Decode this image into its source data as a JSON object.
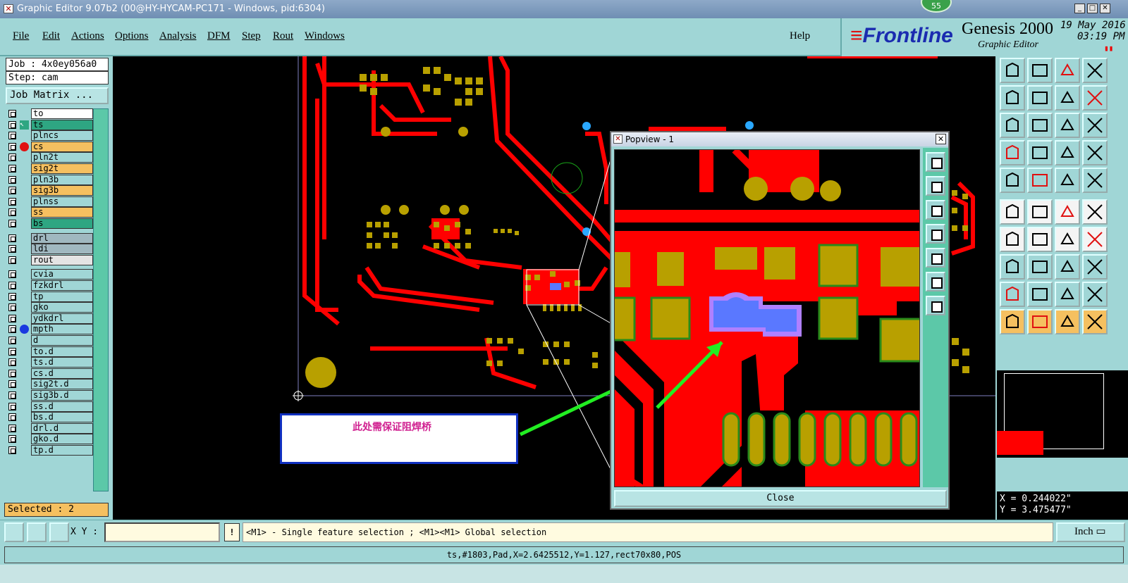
{
  "window": {
    "title": "Graphic Editor 9.07b2 (00@HY-HYCAM-PC171 - Windows, pid:6304)",
    "badge": "55"
  },
  "menu": [
    "File",
    "Edit",
    "Actions",
    "Options",
    "Analysis",
    "DFM",
    "Step",
    "Rout",
    "Windows"
  ],
  "help": "Help",
  "brand": {
    "logo": "Frontline",
    "product": "Genesis 2000",
    "subtitle": "Graphic Editor",
    "date": "19 May 2016",
    "time": "03:19 PM"
  },
  "job": {
    "job_label": "Job : 4x0ey056a0",
    "step_label": "Step: cam",
    "matrix_button": "Job Matrix ..."
  },
  "layers": [
    {
      "name": "to",
      "color": "#ffffff",
      "dot": ""
    },
    {
      "name": "ts",
      "color": "#2ea682",
      "dot": "arrow"
    },
    {
      "name": "plncs",
      "color": "#a0d6d6",
      "dot": ""
    },
    {
      "name": "cs",
      "color": "#f5c060",
      "dot": "#e01010"
    },
    {
      "name": "pln2t",
      "color": "#a0d6d6",
      "dot": ""
    },
    {
      "name": "sig2t",
      "color": "#f5c060",
      "dot": ""
    },
    {
      "name": "pln3b",
      "color": "#a0d6d6",
      "dot": ""
    },
    {
      "name": "sig3b",
      "color": "#f5c060",
      "dot": ""
    },
    {
      "name": "plnss",
      "color": "#a0d6d6",
      "dot": ""
    },
    {
      "name": "ss",
      "color": "#f5c060",
      "dot": ""
    },
    {
      "name": "bs",
      "color": "#2ea682",
      "dot": ""
    },
    {
      "name": "drl",
      "color": "#a0b8c0",
      "dot": ""
    },
    {
      "name": "ldi",
      "color": "#a0b8c0",
      "dot": ""
    },
    {
      "name": "rout",
      "color": "#e4e4e4",
      "dot": ""
    },
    {
      "name": "cvia",
      "color": "#a0d6d6",
      "dot": ""
    },
    {
      "name": "fzkdrl",
      "color": "#a0d6d6",
      "dot": ""
    },
    {
      "name": "tp",
      "color": "#a0d6d6",
      "dot": ""
    },
    {
      "name": "gko",
      "color": "#a0d6d6",
      "dot": ""
    },
    {
      "name": "ydkdrl",
      "color": "#a0d6d6",
      "dot": ""
    },
    {
      "name": "mpth",
      "color": "#a0d6d6",
      "dot": "#1a3ae0"
    },
    {
      "name": "d",
      "color": "#a0d6d6",
      "dot": ""
    },
    {
      "name": "to.d",
      "color": "#a0d6d6",
      "dot": ""
    },
    {
      "name": "ts.d",
      "color": "#a0d6d6",
      "dot": ""
    },
    {
      "name": "cs.d",
      "color": "#a0d6d6",
      "dot": ""
    },
    {
      "name": "sig2t.d",
      "color": "#a0d6d6",
      "dot": ""
    },
    {
      "name": "sig3b.d",
      "color": "#a0d6d6",
      "dot": ""
    },
    {
      "name": "ss.d",
      "color": "#a0d6d6",
      "dot": ""
    },
    {
      "name": "bs.d",
      "color": "#a0d6d6",
      "dot": ""
    },
    {
      "name": "drl.d",
      "color": "#a0d6d6",
      "dot": ""
    },
    {
      "name": "gko.d",
      "color": "#a0d6d6",
      "dot": ""
    },
    {
      "name": "tp.d",
      "color": "#a0d6d6",
      "dot": ""
    }
  ],
  "selected": "Selected : 2",
  "note": "此处需保证阻焊桥",
  "popview": {
    "title": "Popview - 1",
    "close_button": "Close"
  },
  "coords": {
    "x": "X = 0.244022\"",
    "y": "Y = 3.475477\""
  },
  "bottom": {
    "xy_label": "X Y :",
    "xy_value": "",
    "excl": "!",
    "hint": "<M1> - Single feature selection ; <M1><M1> Global selection",
    "unit": "Inch"
  },
  "status": "ts,#1803,Pad,X=2.6425512,Y=1.127,rect70x80,POS",
  "colors": {
    "copper": "#ff0000",
    "pad": "#b8a000",
    "selection": "#5a78ff",
    "arrow": "#22ee22",
    "background": "#000000",
    "panel": "#a0d6d6"
  }
}
